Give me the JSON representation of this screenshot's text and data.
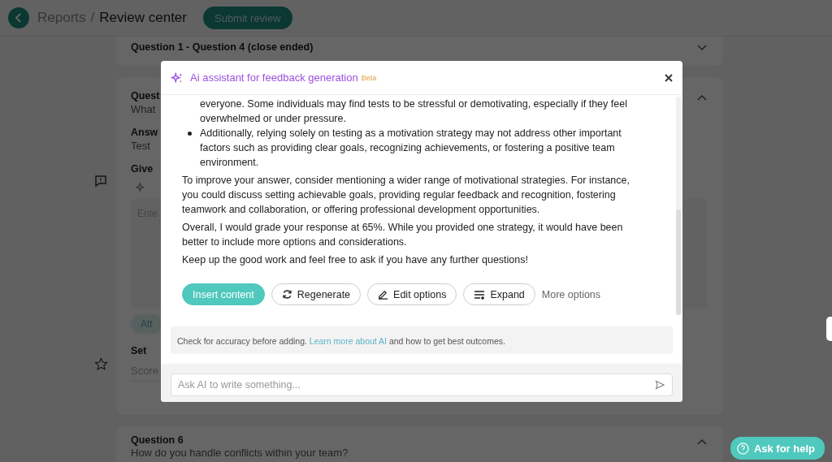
{
  "header": {
    "breadcrumb": [
      {
        "label": "Reports",
        "current": false
      },
      {
        "label": "Review center",
        "current": true
      }
    ],
    "separator": "/",
    "submit_button": "Submit review"
  },
  "page": {
    "collapsed_section": {
      "title": "Question 1 - Question 4 (close ended)",
      "expanded": false
    },
    "question_card": {
      "title": "Quest",
      "question": "What",
      "answer_label": "Answ",
      "answer": "Test",
      "feedback_label": "Give",
      "feedback_placeholder": "Ente",
      "attach_button": "Att",
      "score_label": "Set",
      "score_placeholder": "Score",
      "expanded": true
    },
    "next_question": {
      "title": "Question 6",
      "question": "How do you handle conflicts within your team?",
      "expanded": true
    }
  },
  "help_button": "Ask for help",
  "dialog": {
    "title": "Ai assistant for feedback generation",
    "badge": "Beta",
    "response": [
      {
        "kind": "continuation",
        "text": "everyone. Some individuals may find tests to be stressful or demotivating, especially if they feel overwhelmed or under pressure."
      },
      {
        "kind": "bullet",
        "text": "Additionally, relying solely on testing as a motivation strategy may not address other important factors such as providing clear goals, recognizing achievements, or fostering a positive team environment."
      },
      {
        "kind": "paragraph",
        "text": "To improve your answer, consider mentioning a wider range of motivational strategies. For instance, you could discuss setting achievable goals, providing regular feedback and recognition, fostering teamwork and collaboration, or offering professional development opportunities."
      },
      {
        "kind": "paragraph",
        "text": "Overall, I would grade your response at 65%. While you provided one strategy, it would have been better to include more options and considerations."
      },
      {
        "kind": "paragraph",
        "text": "Keep up the good work and feel free to ask if you have any further questions!"
      }
    ],
    "actions": [
      {
        "label": "Insert content",
        "kind": "primary"
      },
      {
        "label": "Regenerate",
        "kind": "regenerate"
      },
      {
        "label": "Edit options",
        "kind": "edit"
      },
      {
        "label": "Expand",
        "kind": "expand"
      },
      {
        "label": "More options",
        "kind": "link"
      }
    ],
    "notice": {
      "before": "Check for accuracy before adding.",
      "link": "Learn more about AI",
      "after": "and how to get best outcomes."
    },
    "prompt_placeholder": "Ask AI to write something..."
  }
}
